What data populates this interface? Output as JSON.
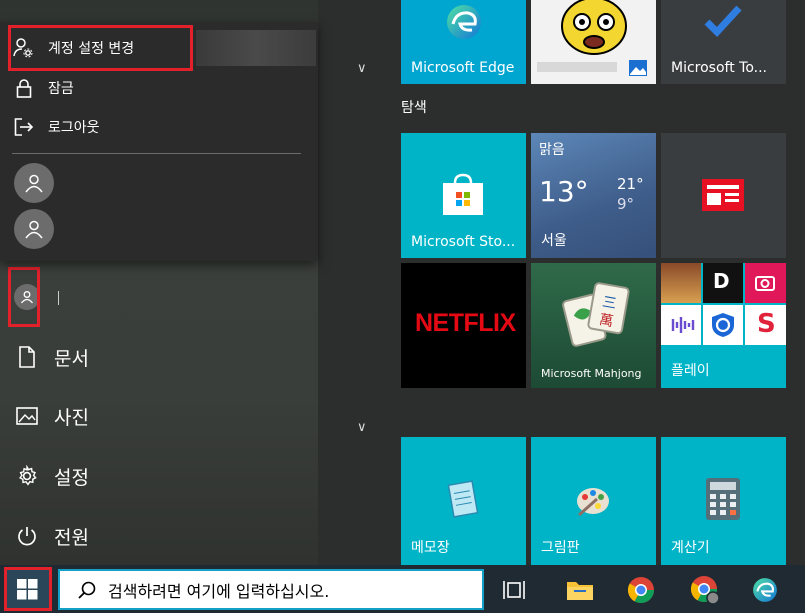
{
  "account_menu": {
    "change_settings": "계정 설정 변경",
    "lock": "잠금",
    "sign_out": "로그아웃"
  },
  "nav": {
    "documents": "문서",
    "pictures": "사진",
    "settings": "설정",
    "power": "전원"
  },
  "groups": {
    "explore": "탐색"
  },
  "tiles": {
    "edge": "Microsoft Edge",
    "todo": "Microsoft To...",
    "store": "Microsoft Sto...",
    "weather_condition": "맑음",
    "weather_temp": "13°",
    "weather_high": "21°",
    "weather_low": "9°",
    "weather_city": "서울",
    "netflix": "NETFLIX",
    "mahjong": "Microsoft Mahjong",
    "play": "플레이",
    "notepad": "메모장",
    "paint": "그림판",
    "calculator": "계산기"
  },
  "taskbar": {
    "search_placeholder": "검색하려면 여기에 입력하십시오."
  },
  "colors": {
    "tile_teal": "#00b4c8",
    "tile_dark": "#3a3d3f",
    "highlight_red": "#e2212b",
    "taskbar_bg": "#1f2a33"
  }
}
